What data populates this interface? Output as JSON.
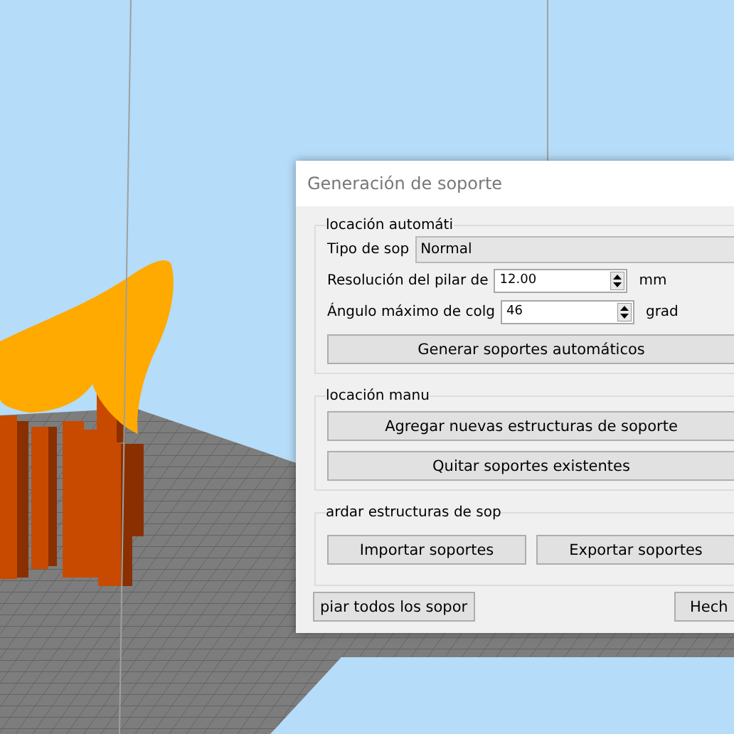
{
  "dialog": {
    "title": "Generación de soporte",
    "groups": [
      {
        "legend": "locación automáti",
        "items": [
          {
            "kind": "combo",
            "label": "Tipo de sop",
            "value": "Normal"
          },
          {
            "kind": "spin",
            "label": "Resolución del pilar de",
            "value": "12.00",
            "unit": "mm"
          },
          {
            "kind": "spin",
            "label": "Ángulo máximo de colg",
            "value": "46",
            "unit": "grad"
          },
          {
            "kind": "button",
            "label": "Generar soportes automáticos"
          }
        ]
      },
      {
        "legend": "locación manu",
        "items": [
          {
            "kind": "button",
            "label": "Agregar nuevas estructuras de soporte"
          },
          {
            "kind": "button",
            "label": "Quitar soportes existentes"
          }
        ]
      },
      {
        "legend": "ardar estructuras de sop",
        "items": [
          {
            "kind": "buttonpair",
            "labels": [
              "Importar soportes",
              "Exportar soportes"
            ]
          }
        ]
      }
    ],
    "footer_buttons": [
      "piar todos los sopor",
      "Hech"
    ]
  }
}
